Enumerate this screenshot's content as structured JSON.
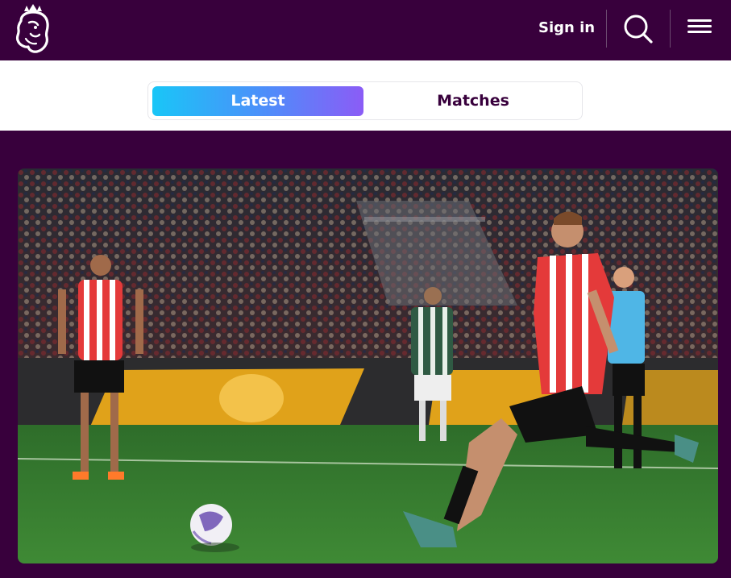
{
  "header": {
    "logo_name": "premier-league-lion-logo",
    "signin_label": "Sign in",
    "search_icon": "search-icon",
    "menu_icon": "hamburger-menu-icon"
  },
  "tabs": [
    {
      "label": "Latest",
      "active": true
    },
    {
      "label": "Matches",
      "active": false
    }
  ],
  "hero": {
    "image": "football-match-penalty-kick-photo"
  },
  "colors": {
    "brand_purple": "#38003c",
    "tab_gradient_start": "#19c6f7",
    "tab_gradient_end": "#8b5cf6"
  }
}
